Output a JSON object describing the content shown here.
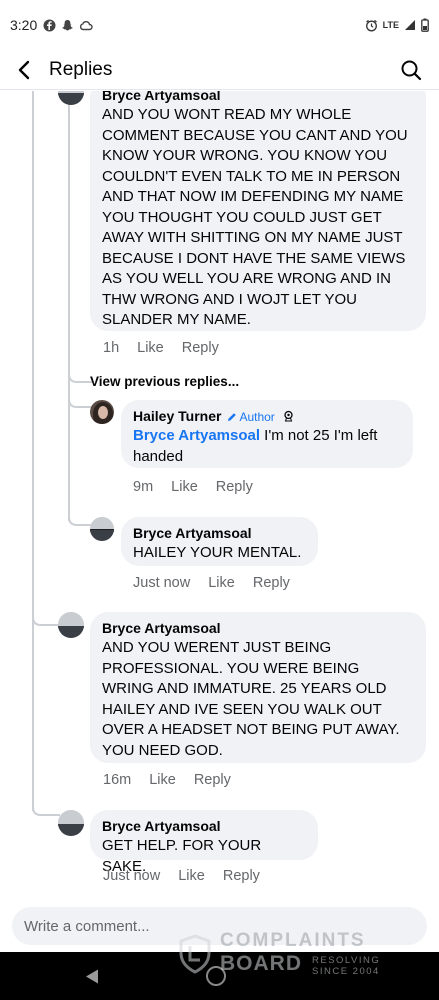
{
  "status_bar": {
    "time": "3:20",
    "network": "LTE",
    "icons": [
      "facebook-icon",
      "snapchat-icon",
      "cloud-icon",
      "moon-icon",
      "alarm-icon",
      "signal-icon",
      "battery-icon"
    ]
  },
  "header": {
    "title": "Replies",
    "back_icon": "chevron-left-icon",
    "search_icon": "search-icon"
  },
  "comments": [
    {
      "author": "Bryce Artyamsoal",
      "text": "AND YOU WONT READ MY WHOLE COMMENT BECAUSE YOU CANT AND YOU KNOW YOUR WRONG. YOU KNOW YOU COULDN'T EVEN TALK TO ME IN PERSON AND THAT NOW IM DEFENDING MY NAME YOU THOUGHT YOU COULD JUST GET AWAY WITH SHITTING ON MY NAME JUST BECAUSE I DONT HAVE THE SAME VIEWS AS YOU WELL YOU ARE WRONG AND IN THW WRONG AND I WOJT LET YOU SLANDER MY NAME.",
      "time": "1h",
      "like": "Like",
      "reply": "Reply"
    },
    {
      "author": "Hailey Turner",
      "badge": "Author",
      "mention": "Bryce Artyamsoal",
      "text": " I'm not 25 I'm left handed",
      "time": "9m",
      "like": "Like",
      "reply": "Reply"
    },
    {
      "author": "Bryce Artyamsoal",
      "text": "HAILEY YOUR MENTAL.",
      "time": "Just now",
      "like": "Like",
      "reply": "Reply"
    },
    {
      "author": "Bryce Artyamsoal",
      "text": "AND YOU WERENT JUST BEING PROFESSIONAL. YOU WERE BEING WRING AND IMMATURE. 25 YEARS OLD HAILEY AND IVE SEEN YOU WALK OUT OVER A HEADSET NOT BEING PUT AWAY. YOU NEED GOD.",
      "time": "16m",
      "like": "Like",
      "reply": "Reply"
    },
    {
      "author": "Bryce Artyamsoal",
      "text": "GET HELP. FOR YOUR SAKE.",
      "time": "Just now",
      "like": "Like",
      "reply": "Reply"
    }
  ],
  "view_previous": "View previous replies...",
  "composer": {
    "placeholder": "Write a comment..."
  },
  "watermark": {
    "line1": "COMPLAINTS",
    "line2": "BOARD",
    "line3": "RESOLVING SINCE 2004"
  }
}
